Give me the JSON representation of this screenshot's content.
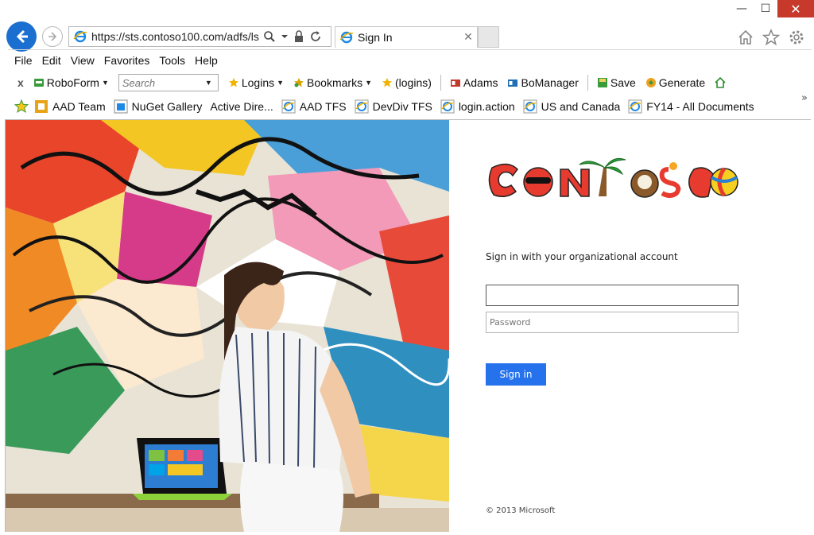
{
  "window": {
    "minimize_glyph": "—",
    "maximize_glyph": "☐",
    "close_glyph": "✕"
  },
  "navigation": {
    "url": "https://sts.contoso100.com/adfs/ls",
    "tab_title": "Sign In",
    "tab_close_glyph": "✕"
  },
  "menu": {
    "items": [
      "File",
      "Edit",
      "View",
      "Favorites",
      "Tools",
      "Help"
    ]
  },
  "roboform": {
    "close_glyph": "x",
    "brand_label": "RoboForm",
    "search_placeholder": "Search",
    "logins_label": "Logins",
    "bookmarks_label": "Bookmarks",
    "logins_alt_label": "(logins)",
    "adams_label": "Adams",
    "bomanager_label": "BoManager",
    "save_label": "Save",
    "generate_label": "Generate"
  },
  "favorites": {
    "items": [
      "AAD Team",
      "NuGet Gallery",
      "Active Dire...",
      "AAD TFS",
      "DevDiv TFS",
      "login.action",
      "US and Canada",
      "FY14 - All Documents"
    ],
    "more_glyph": "»"
  },
  "signin": {
    "logo_text": "CONTOSO",
    "title": "Sign in with your organizational account",
    "username_value": "",
    "username_placeholder": "",
    "password_placeholder": "Password",
    "button_label": "Sign in",
    "copyright": "© 2013 Microsoft"
  },
  "colors": {
    "accent": "#2672ec",
    "back_button": "#1a6fd0",
    "close_button": "#c7392b"
  }
}
